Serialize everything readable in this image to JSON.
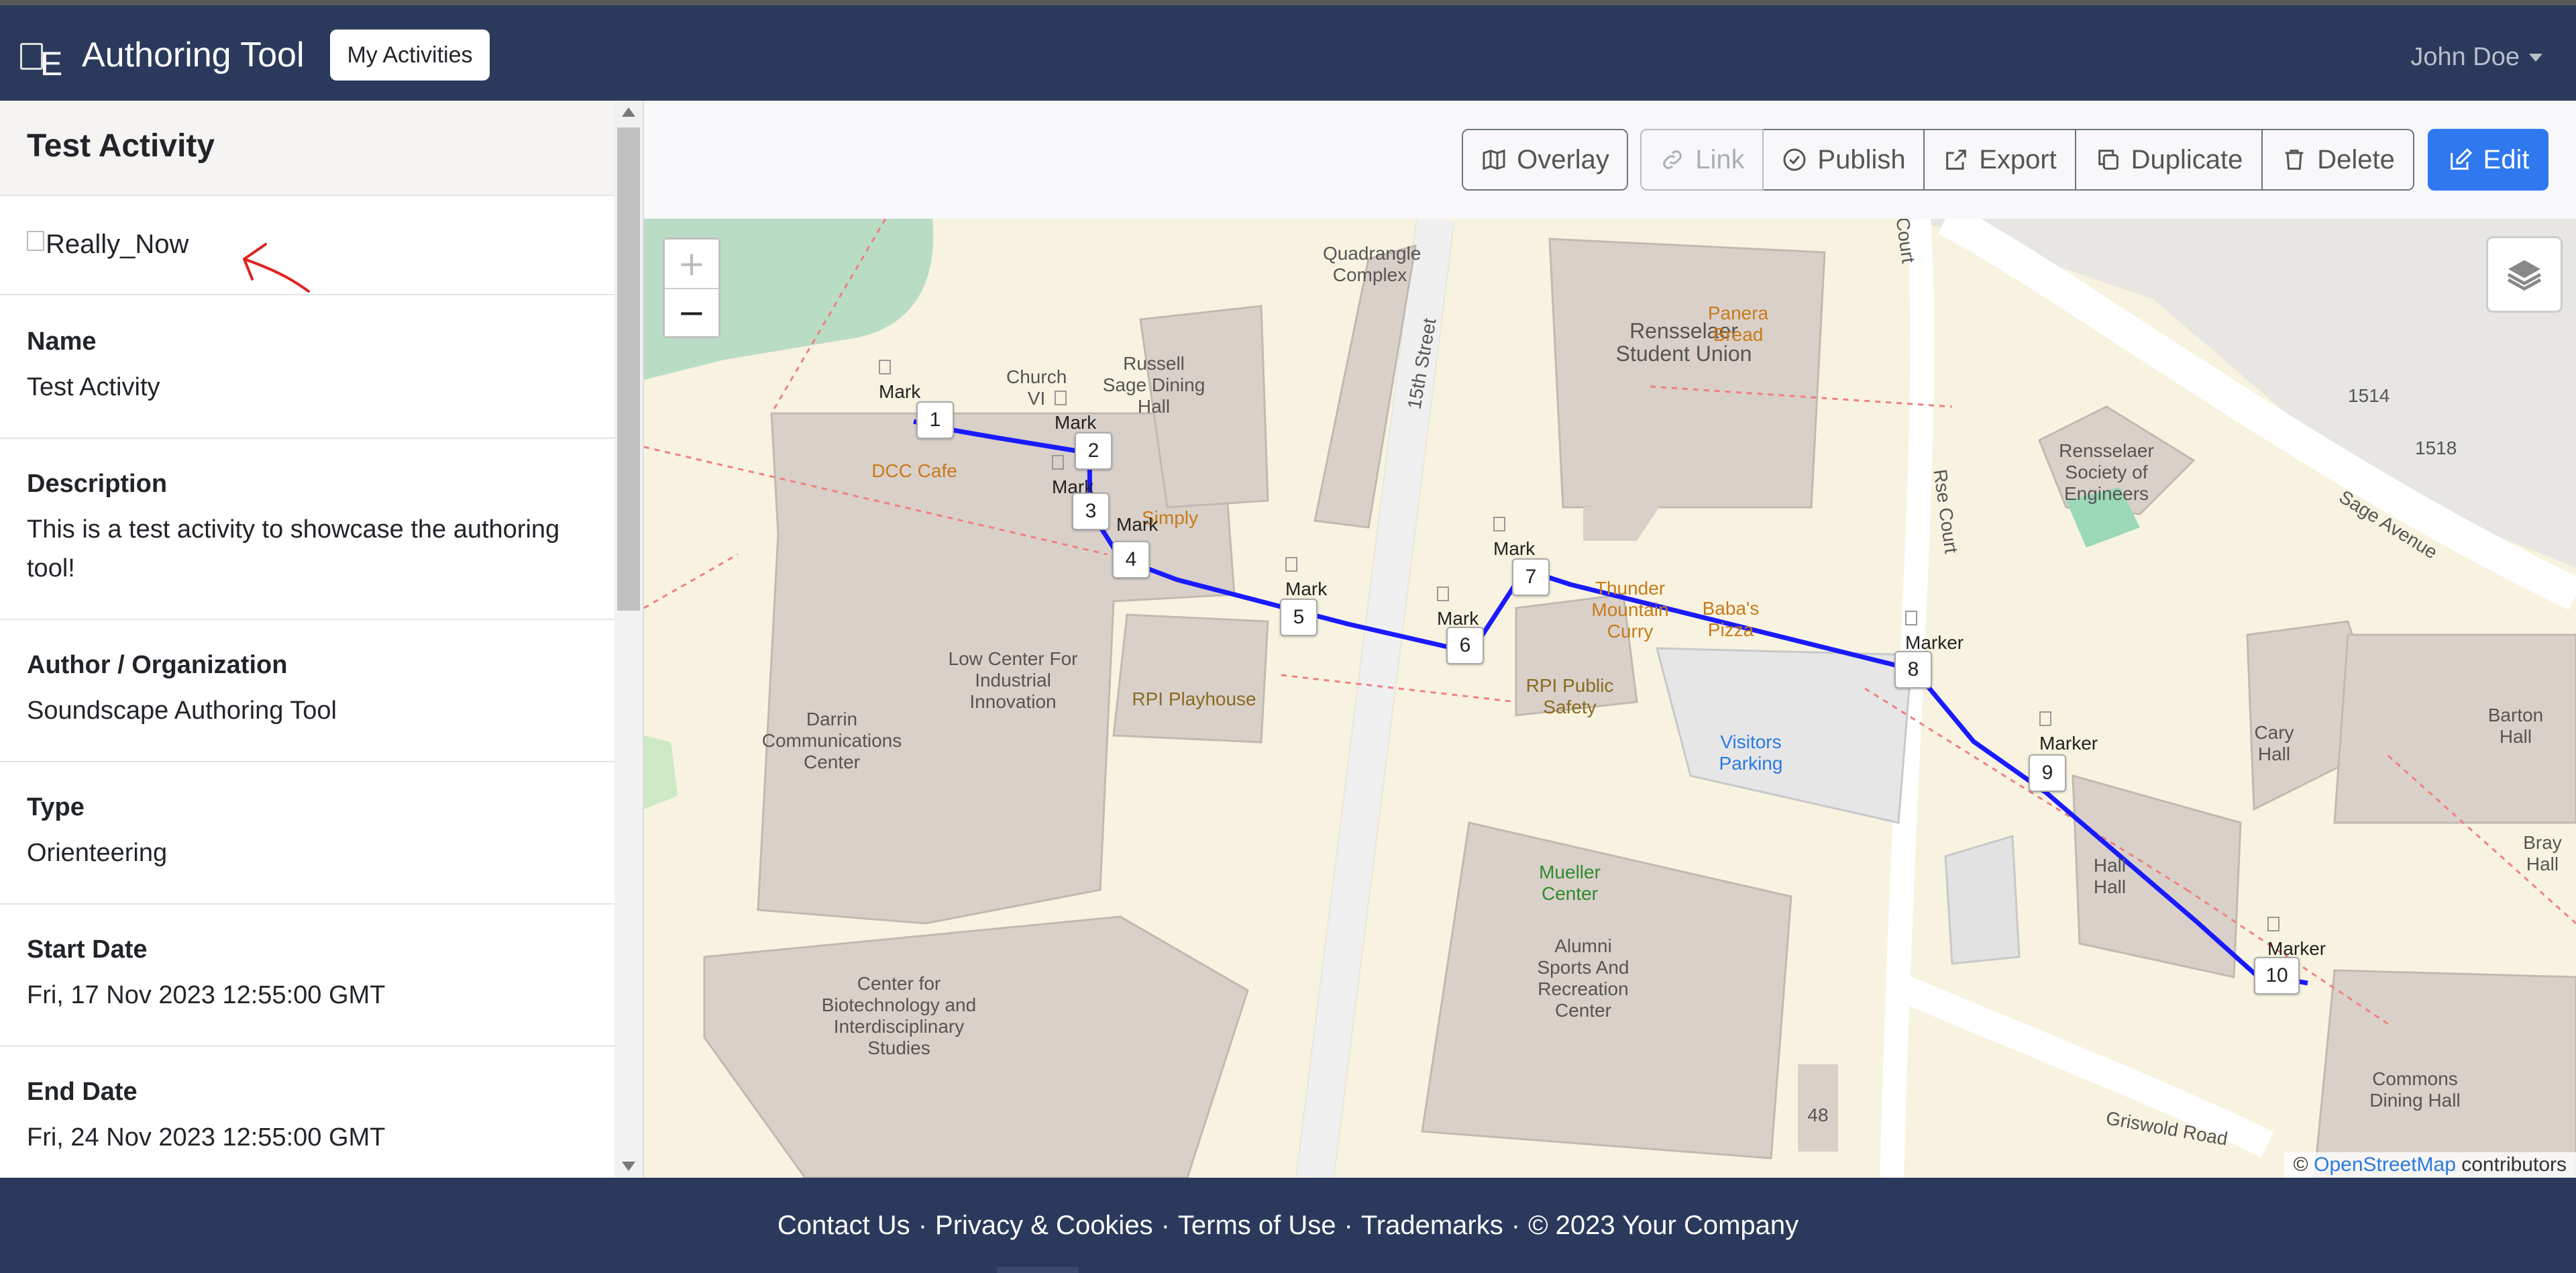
{
  "app": {
    "title": "Authoring Tool",
    "brand_image_alt": "E",
    "nav_button": "My Activities",
    "user": "John Doe"
  },
  "activity": {
    "title": "Test Activity",
    "image_alt": "Really_Now",
    "fields": [
      {
        "label": "Name",
        "value": "Test Activity"
      },
      {
        "label": "Description",
        "value": "This is a test activity to showcase the authoring tool!"
      },
      {
        "label": "Author / Organization",
        "value": "Soundscape Authoring Tool"
      },
      {
        "label": "Type",
        "value": "Orienteering"
      },
      {
        "label": "Start Date",
        "value": "Fri, 17 Nov 2023 12:55:00 GMT"
      },
      {
        "label": "End Date",
        "value": "Fri, 24 Nov 2023 12:55:00 GMT"
      }
    ]
  },
  "toolbar": {
    "overlay": "Overlay",
    "link": "Link",
    "publish": "Publish",
    "export": "Export",
    "duplicate": "Duplicate",
    "delete": "Delete",
    "edit": "Edit"
  },
  "map": {
    "zoom_in": "+",
    "zoom_out": "−",
    "attribution_prefix": "©",
    "attribution_link": "OpenStreetMap",
    "attribution_suffix": "contributors",
    "route_color": "#1a1aff",
    "waypoints": [
      "1",
      "2",
      "3",
      "4",
      "5",
      "6",
      "7",
      "8",
      "9",
      "10"
    ],
    "marker_alt_short": "Mark",
    "marker_alt_long": "Marker",
    "labels": [
      "Quadrangle Complex",
      "15th Street",
      "Rensselaer Student Union",
      "Panera Bread",
      "Church VI",
      "Russell Sage Dining Hall",
      "DCC Cafe",
      "Simply",
      "Darrin Communications Center",
      "Low Center For Industrial Innovation",
      "RPI Playhouse",
      "RPI Public Safety",
      "Visitors Parking",
      "Rse Court",
      "Rensselaer Society of Engineers",
      "Sage Avenue",
      "1514",
      "1518",
      "Thunder Mountain Curry",
      "Baba's Pizza",
      "Mueller Center",
      "Alumni Sports And Recreation Center",
      "Center for Biotechnology and Interdisciplinary Studies",
      "Griswold Road",
      "Cary Hall",
      "Barton Hall",
      "Bray Hall",
      "Hall Hall",
      "Commons Dining Hall",
      "48",
      "Court"
    ]
  },
  "footer": {
    "links": [
      "Contact Us",
      "Privacy & Cookies",
      "Terms of Use",
      "Trademarks",
      "© 2023 Your Company"
    ],
    "separator": "·"
  }
}
